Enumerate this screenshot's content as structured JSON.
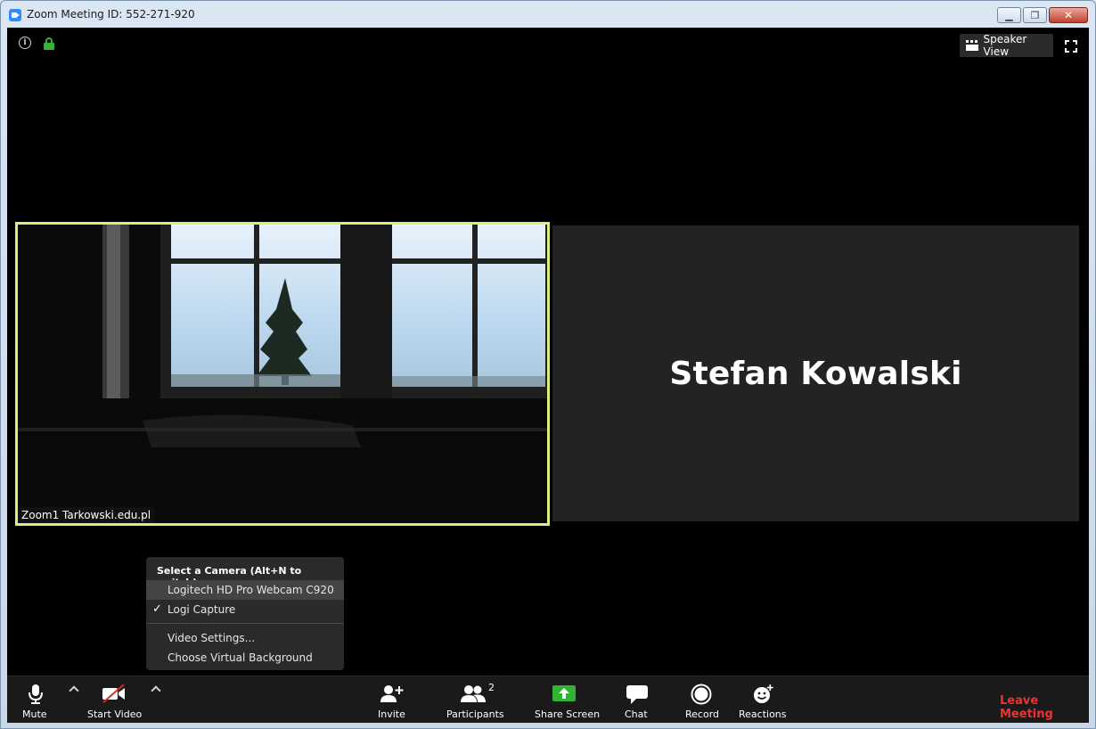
{
  "window": {
    "title": "Zoom Meeting ID: 552-271-920",
    "controls": {
      "minimize": "▁",
      "restore": "❐",
      "close": "✕"
    }
  },
  "top_bar": {
    "info_icon": "info-icon",
    "lock_icon": "lock-icon",
    "speaker_view_label": "Speaker View",
    "fullscreen_icon": "fullscreen-icon"
  },
  "participants": {
    "self": {
      "name": "Zoom1 Tarkowski.edu.pl"
    },
    "remote": {
      "name": "Stefan Kowalski"
    }
  },
  "camera_menu": {
    "header": "Select a Camera (Alt+N to switch)",
    "cameras": [
      {
        "label": "Logitech HD Pro Webcam C920",
        "selected": false,
        "highlighted": true
      },
      {
        "label": "Logi Capture",
        "selected": true,
        "highlighted": false
      }
    ],
    "check_glyph": "✓",
    "actions": [
      "Video Settings...",
      "Choose Virtual Background"
    ]
  },
  "toolbar": {
    "mute_label": "Mute",
    "start_video_label": "Start Video",
    "invite_label": "Invite",
    "participants_label": "Participants",
    "participants_count": "2",
    "share_screen_label": "Share Screen",
    "chat_label": "Chat",
    "record_label": "Record",
    "reactions_label": "Reactions",
    "leave_label": "Leave Meeting"
  },
  "colors": {
    "active_speaker_border": "#d8ee7e",
    "lock": "#34b233",
    "share_screen": "#34b233",
    "leave": "#ec3434",
    "video_off_slash": "#e02828"
  }
}
